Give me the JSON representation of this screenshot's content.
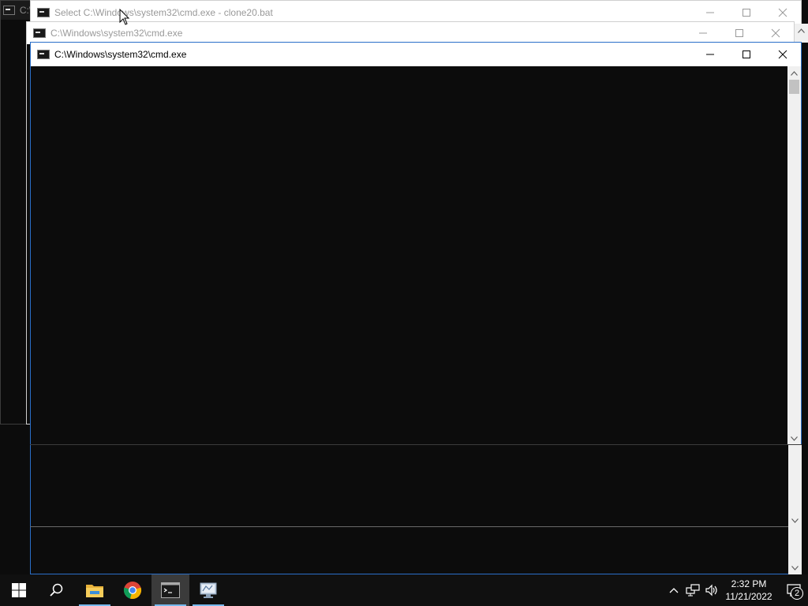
{
  "windows": {
    "back_partial": {
      "title": "C:\\"
    },
    "select_window": {
      "title": "Select C:\\Windows\\system32\\cmd.exe - clone20.bat"
    },
    "middle_window": {
      "title": "C:\\Windows\\system32\\cmd.exe"
    },
    "front_window": {
      "title": "C:\\Windows\\system32\\cmd.exe"
    }
  },
  "taskbar": {
    "start": "start-icon",
    "search": "search-icon",
    "apps": [
      "file-explorer-icon",
      "chrome-icon",
      "cmd-icon",
      "network-app-icon"
    ],
    "tray": {
      "chevron": "chevron-up-icon",
      "network": "network-icon",
      "volume": "volume-icon",
      "time": "2:32 PM",
      "date": "11/21/2022",
      "notification_count": "2"
    }
  },
  "colors": {
    "console_bg": "#0c0c0c",
    "taskbar_bg": "#101010",
    "accent": "#76b9ed"
  }
}
